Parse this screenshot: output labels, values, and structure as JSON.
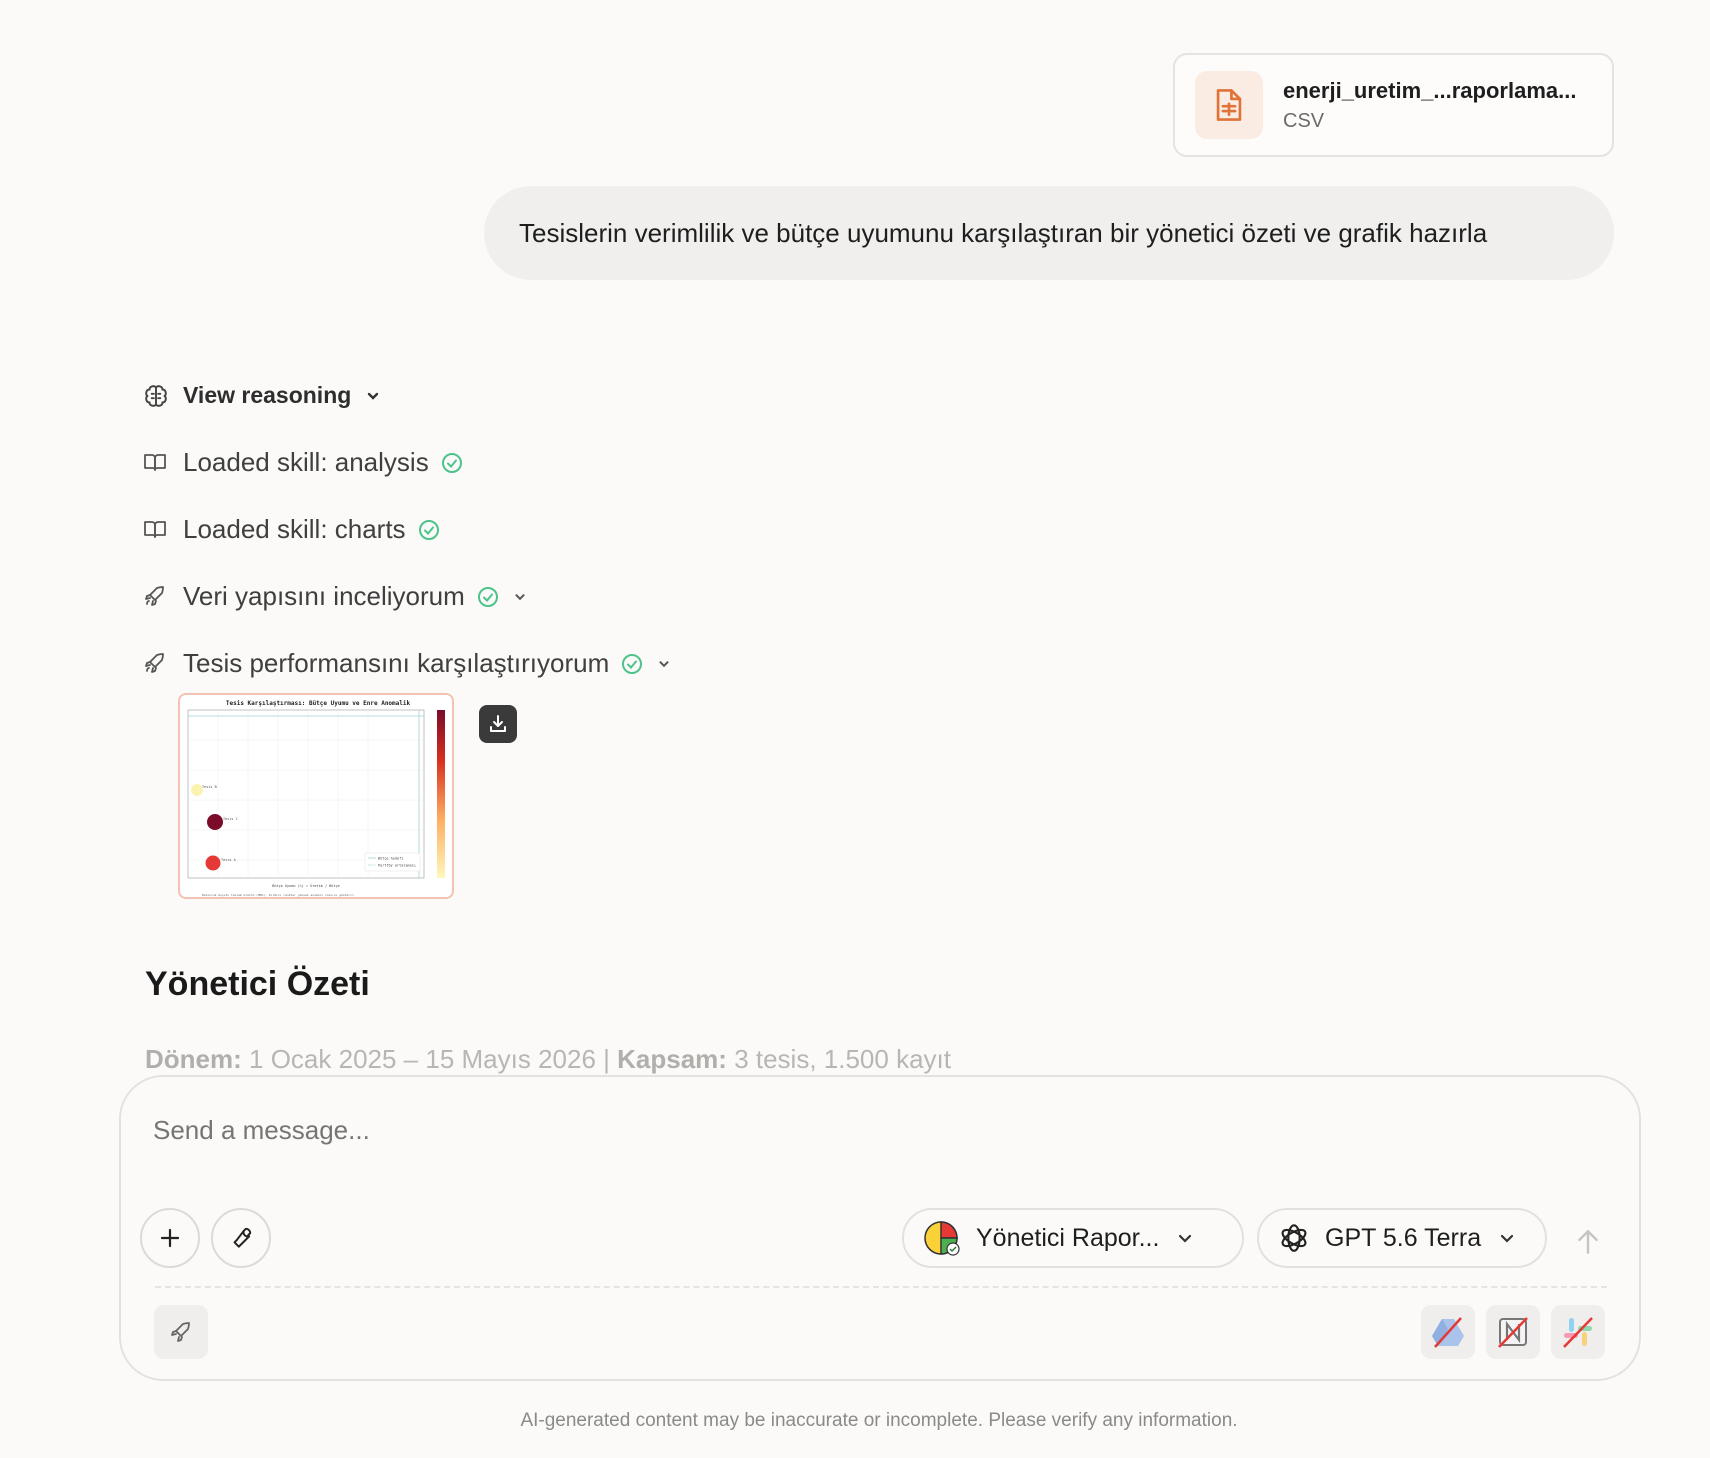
{
  "attachment": {
    "name": "enerji_uretim_...raporlama...",
    "type": "CSV"
  },
  "user_message": "Tesislerin verimlilik ve bütçe uyumunu karşılaştıran bir yönetici özeti ve grafik hazırla",
  "reasoning_label": "View reasoning",
  "steps": [
    {
      "label": "Loaded skill: analysis",
      "icon": "book-icon",
      "status": "done"
    },
    {
      "label": "Loaded skill: charts",
      "icon": "book-icon",
      "status": "done"
    },
    {
      "label": "Veri yapısını inceliyorum",
      "icon": "rocket-icon",
      "status": "done"
    },
    {
      "label": "Tesis performansını karşılaştırıyorum",
      "icon": "rocket-icon",
      "status": "done"
    }
  ],
  "chart_thumbnail": {
    "title": "Tesis Karşılaştırması: Bütçe Uyumu ve Enre Anomalik",
    "xlabel": "Bütçe Uyumu (%) = Üretim / Bütçe",
    "point_labels": [
      "Tesis B",
      "Tesis C",
      "Tesis A"
    ],
    "legend": [
      "Bütçe hedefi",
      "Portföy ortalaması"
    ],
    "footnote": "Baloncuk boyutu toplam üretim (MWh). Kırmızı renkler yüksek anomali oranını gösterir.",
    "colors": {
      "Tesis B": "#fdf3b0",
      "Tesis C": "#7a0c2a",
      "Tesis A": "#e53935"
    }
  },
  "summary": {
    "title": "Yönetici Özeti",
    "period_label": "Dönem:",
    "period_value": "1 Ocak 2025 – 15 Mayıs 2026 |",
    "scope_label": "Kapsam:",
    "scope_value": "3 tesis, 1.500 kayıt"
  },
  "composer": {
    "placeholder": "Send a message...",
    "agent_label": "Yönetici Rapor...",
    "model_label": "GPT 5.6 Terra"
  },
  "disclaimer": "AI-generated content may be inaccurate or incomplete. Please verify any information.",
  "colors": {
    "accent_orange": "#e0733a",
    "check_green": "#4cc38a"
  }
}
